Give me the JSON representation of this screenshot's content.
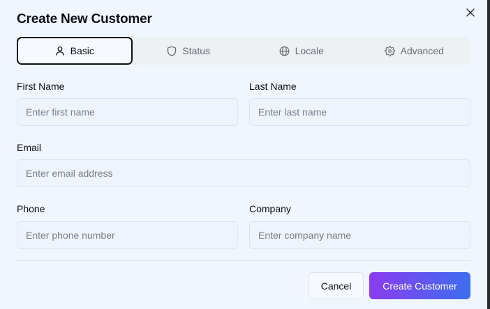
{
  "dialog": {
    "title": "Create New Customer",
    "close_icon": "close-icon"
  },
  "tabs": [
    {
      "label": "Basic",
      "icon": "user-icon",
      "active": true
    },
    {
      "label": "Status",
      "icon": "shield-icon",
      "active": false
    },
    {
      "label": "Locale",
      "icon": "globe-icon",
      "active": false
    },
    {
      "label": "Advanced",
      "icon": "gear-icon",
      "active": false
    }
  ],
  "form": {
    "first_name": {
      "label": "First Name",
      "placeholder": "Enter first name",
      "value": ""
    },
    "last_name": {
      "label": "Last Name",
      "placeholder": "Enter last name",
      "value": ""
    },
    "email": {
      "label": "Email",
      "placeholder": "Enter email address",
      "value": ""
    },
    "phone": {
      "label": "Phone",
      "placeholder": "Enter phone number",
      "value": ""
    },
    "company": {
      "label": "Company",
      "placeholder": "Enter company name",
      "value": ""
    }
  },
  "actions": {
    "cancel_label": "Cancel",
    "create_label": "Create Customer"
  },
  "colors": {
    "dialog_background": "#f0f6fe",
    "primary_gradient_start": "#8b3cf0",
    "primary_gradient_end": "#3d6ef0",
    "text": "#0d0f14",
    "muted_text": "#666b73"
  }
}
